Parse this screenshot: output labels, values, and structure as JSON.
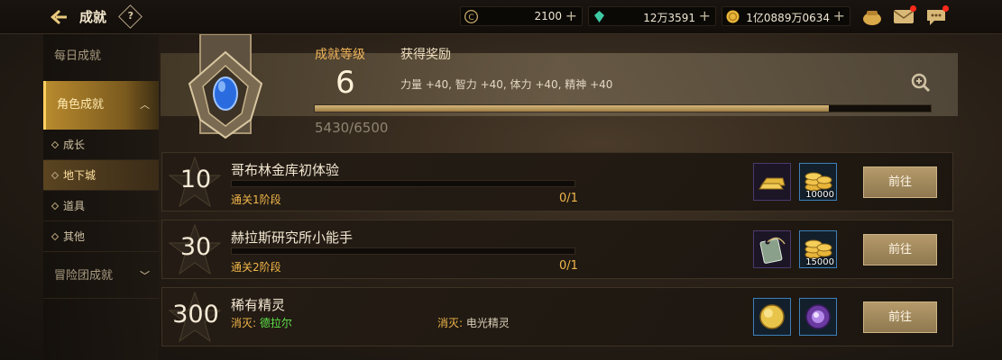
{
  "topbar": {
    "title": "成就",
    "help_label": "?",
    "currencies": [
      {
        "icon": "credit-icon",
        "value": "2100"
      },
      {
        "icon": "gem-icon",
        "value": "12万3591"
      },
      {
        "icon": "gold-coin-icon",
        "value": "1亿0889万0634"
      }
    ],
    "plus": "+"
  },
  "sidebar": {
    "daily": "每日成就",
    "character": "角色成就",
    "subitems": [
      "成长",
      "地下城",
      "道具",
      "其他"
    ],
    "adventure": "冒险团成就"
  },
  "header": {
    "level_label": "成就等级",
    "level_value": "6",
    "reward_label": "获得奖励",
    "reward_text": "力量 +40, 智力 +40, 体力 +40, 精神 +40",
    "progress_text": "5430/6500",
    "progress_fraction": 0.835
  },
  "rows": [
    {
      "points": "10",
      "title": "哥布林金库初体验",
      "condition": "通关1阶段",
      "count": "0/1",
      "rewards": [
        {
          "icon": "gold-bar-icon",
          "qty": ""
        },
        {
          "icon": "gold-coins-icon",
          "qty": "10000"
        }
      ],
      "button": "前往"
    },
    {
      "points": "30",
      "title": "赫拉斯研究所小能手",
      "condition": "通关2阶段",
      "count": "0/1",
      "rewards": [
        {
          "icon": "tag-icon",
          "qty": ""
        },
        {
          "icon": "gold-coins-icon",
          "qty": "15000"
        }
      ],
      "button": "前往"
    },
    {
      "points": "300",
      "title": "稀有精灵",
      "cond_key": "消灭:",
      "cond_a": "德拉尔",
      "cond_b": "电光精灵",
      "rewards": [
        {
          "icon": "gold-orb-icon",
          "qty": ""
        },
        {
          "icon": "purple-orb-icon",
          "qty": ""
        }
      ],
      "button": "前往"
    }
  ],
  "colors": {
    "accent": "#f1b64a",
    "highlight": "#b88a2e",
    "button": "#b59a6a"
  }
}
